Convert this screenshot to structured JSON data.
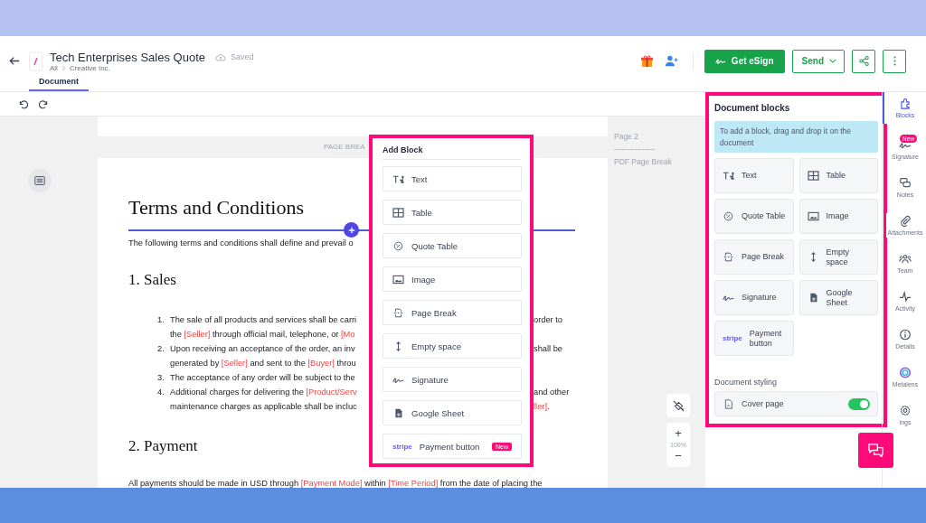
{
  "header": {
    "title": "Tech Enterprises Sales Quote",
    "save_status": "Saved",
    "breadcrumb": [
      "All",
      "Creative Inc."
    ],
    "tabs": [
      {
        "label": "Document",
        "selected": true
      }
    ],
    "esign_label": "Get eSign",
    "send_label": "Send"
  },
  "canvas": {
    "page_break_label": "PAGE BREA",
    "page_note": "Page 2",
    "page_note_rule": "----------------",
    "page_note_break": "PDF Page Break",
    "zoom_in": "+",
    "zoom": "100%",
    "zoom_out": "−"
  },
  "document": {
    "heading": "Terms and Conditions",
    "intro": [
      {
        "kind": "plain",
        "text": "The following terms and conditions shall define and prevail o"
      }
    ],
    "sections": [
      {
        "title": "1. Sales",
        "items": [
          {
            "number": "1.",
            "lines": [
              {
                "left": [
                  {
                    "kind": "plain",
                    "text": "The sale of all products and services shall be carri"
                  }
                ],
                "right": [
                  {
                    "kind": "plain",
                    "text": "order to"
                  }
                ]
              },
              {
                "left": [
                  {
                    "kind": "plain",
                    "text": "the "
                  },
                  {
                    "kind": "field",
                    "text": "[Seller]"
                  },
                  {
                    "kind": "plain",
                    "text": " through official mail, telephone, or "
                  },
                  {
                    "kind": "field",
                    "text": "[Mo"
                  }
                ]
              }
            ]
          },
          {
            "number": "2.",
            "lines": [
              {
                "left": [
                  {
                    "kind": "plain",
                    "text": "Upon receiving an acceptance of the order, an inv"
                  }
                ],
                "right": [
                  {
                    "kind": "plain",
                    "text": "shall be"
                  }
                ]
              },
              {
                "left": [
                  {
                    "kind": "plain",
                    "text": "generated by "
                  },
                  {
                    "kind": "field",
                    "text": "[Seller]"
                  },
                  {
                    "kind": "plain",
                    "text": " and sent to the "
                  },
                  {
                    "kind": "field",
                    "text": "[Buyer]"
                  },
                  {
                    "kind": "plain",
                    "text": " throu"
                  }
                ]
              }
            ]
          },
          {
            "number": "3.",
            "lines": [
              {
                "left": [
                  {
                    "kind": "plain",
                    "text": "The acceptance of any order will be subject to the"
                  }
                ]
              }
            ]
          },
          {
            "number": "4.",
            "lines": [
              {
                "left": [
                  {
                    "kind": "plain",
                    "text": "Additional charges for delivering the "
                  },
                  {
                    "kind": "field",
                    "text": "[Product/Serv"
                  }
                ],
                "right": [
                  {
                    "kind": "plain",
                    "text": "and other"
                  }
                ]
              },
              {
                "left": [
                  {
                    "kind": "plain",
                    "text": "maintenance charges as applicable shall be incluc"
                  }
                ],
                "right": [
                  {
                    "kind": "field",
                    "text": "ller]"
                  },
                  {
                    "kind": "plain",
                    "text": "."
                  }
                ]
              }
            ]
          }
        ]
      },
      {
        "title": "2. Payment",
        "paragraph": [
          {
            "kind": "plain",
            "text": "All payments should be made in USD through "
          },
          {
            "kind": "field",
            "text": "[Payment Mode]"
          },
          {
            "kind": "plain",
            "text": " within "
          },
          {
            "kind": "field",
            "text": "[Time Period]"
          },
          {
            "kind": "plain",
            "text": " from the date of placing the"
          }
        ]
      }
    ]
  },
  "add_block": {
    "title": "Add Block",
    "items": [
      {
        "kind": "text",
        "label": "Text"
      },
      {
        "kind": "table",
        "label": "Table"
      },
      {
        "kind": "quote",
        "label": "Quote Table"
      },
      {
        "kind": "image",
        "label": "Image"
      },
      {
        "kind": "pagebreak",
        "label": "Page Break"
      },
      {
        "kind": "space",
        "label": "Empty space"
      },
      {
        "kind": "signature",
        "label": "Signature"
      },
      {
        "kind": "sheet",
        "label": "Google Sheet"
      },
      {
        "kind": "stripe",
        "logo": "stripe",
        "label": "Payment button",
        "badge": "New"
      }
    ]
  },
  "blocks_panel": {
    "title": "Document blocks",
    "hint": "To add a block, drag and drop it on the document",
    "items": [
      {
        "kind": "text",
        "label": "Text"
      },
      {
        "kind": "table",
        "label": "Table"
      },
      {
        "kind": "quote",
        "label": "Quote Table"
      },
      {
        "kind": "image",
        "label": "Image"
      },
      {
        "kind": "pagebreak",
        "label": "Page Break"
      },
      {
        "kind": "space",
        "label": "Empty space"
      },
      {
        "kind": "signature",
        "label": "Signature"
      },
      {
        "kind": "sheet",
        "label": "Google Sheet"
      },
      {
        "kind": "stripe",
        "logo": "stripe",
        "label": "Payment button"
      }
    ],
    "styling_title": "Document styling",
    "cover": {
      "label": "Cover page",
      "on": true
    }
  },
  "rail": [
    {
      "kind": "blocks",
      "label": "Blocks",
      "selected": true
    },
    {
      "kind": "signature",
      "label": "Signature",
      "selected": false,
      "badge": "New"
    },
    {
      "kind": "notes",
      "label": "Notes",
      "selected": false
    },
    {
      "kind": "attach",
      "label": "Attachments",
      "selected": false
    },
    {
      "kind": "team",
      "label": "Team",
      "selected": false
    },
    {
      "kind": "activity",
      "label": "Activity",
      "selected": false
    },
    {
      "kind": "details",
      "label": "Details",
      "selected": false
    },
    {
      "kind": "metalens",
      "label": "Metalens",
      "selected": false
    },
    {
      "kind": "settings",
      "label": "ings",
      "selected": false
    }
  ]
}
